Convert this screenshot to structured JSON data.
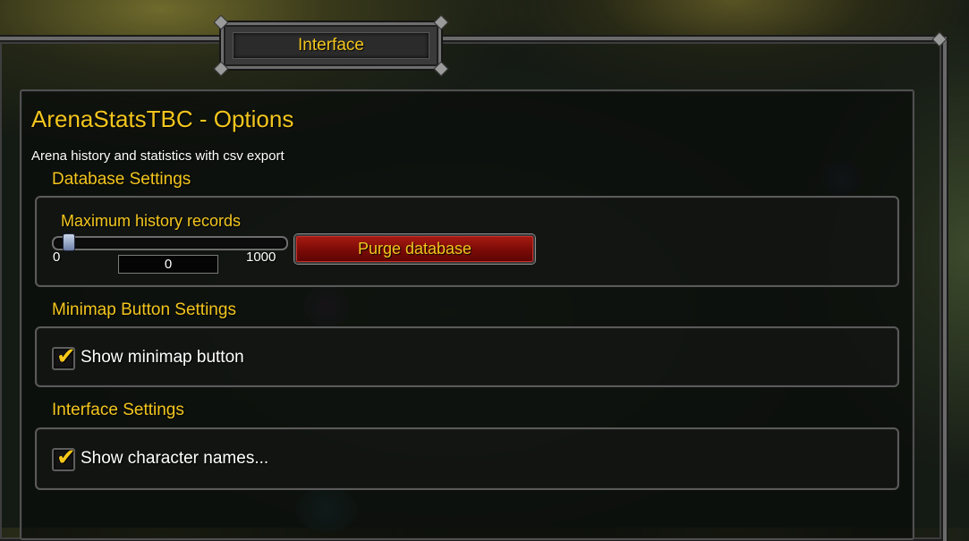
{
  "window": {
    "title": "Interface"
  },
  "addon": {
    "title": "ArenaStatsTBC - Options",
    "description": "Arena history and statistics with csv export"
  },
  "sections": {
    "database": {
      "heading": "Database Settings",
      "slider_label": "Maximum history records",
      "slider_min": "0",
      "slider_max": "1000",
      "slider_value": "0",
      "slider_fraction": 0.0,
      "purge_label": "Purge database"
    },
    "minimap": {
      "heading": "Minimap Button Settings",
      "checkbox_label": "Show minimap button",
      "checked": true
    },
    "interface": {
      "heading": "Interface Settings",
      "checkbox_label": "Show character names...",
      "checked": true
    }
  },
  "colors": {
    "gold_text": "#f3c61e",
    "button_red": "#8b0f0a",
    "white_text": "#ffffff"
  },
  "icons": {
    "checkmark": "check-icon"
  }
}
